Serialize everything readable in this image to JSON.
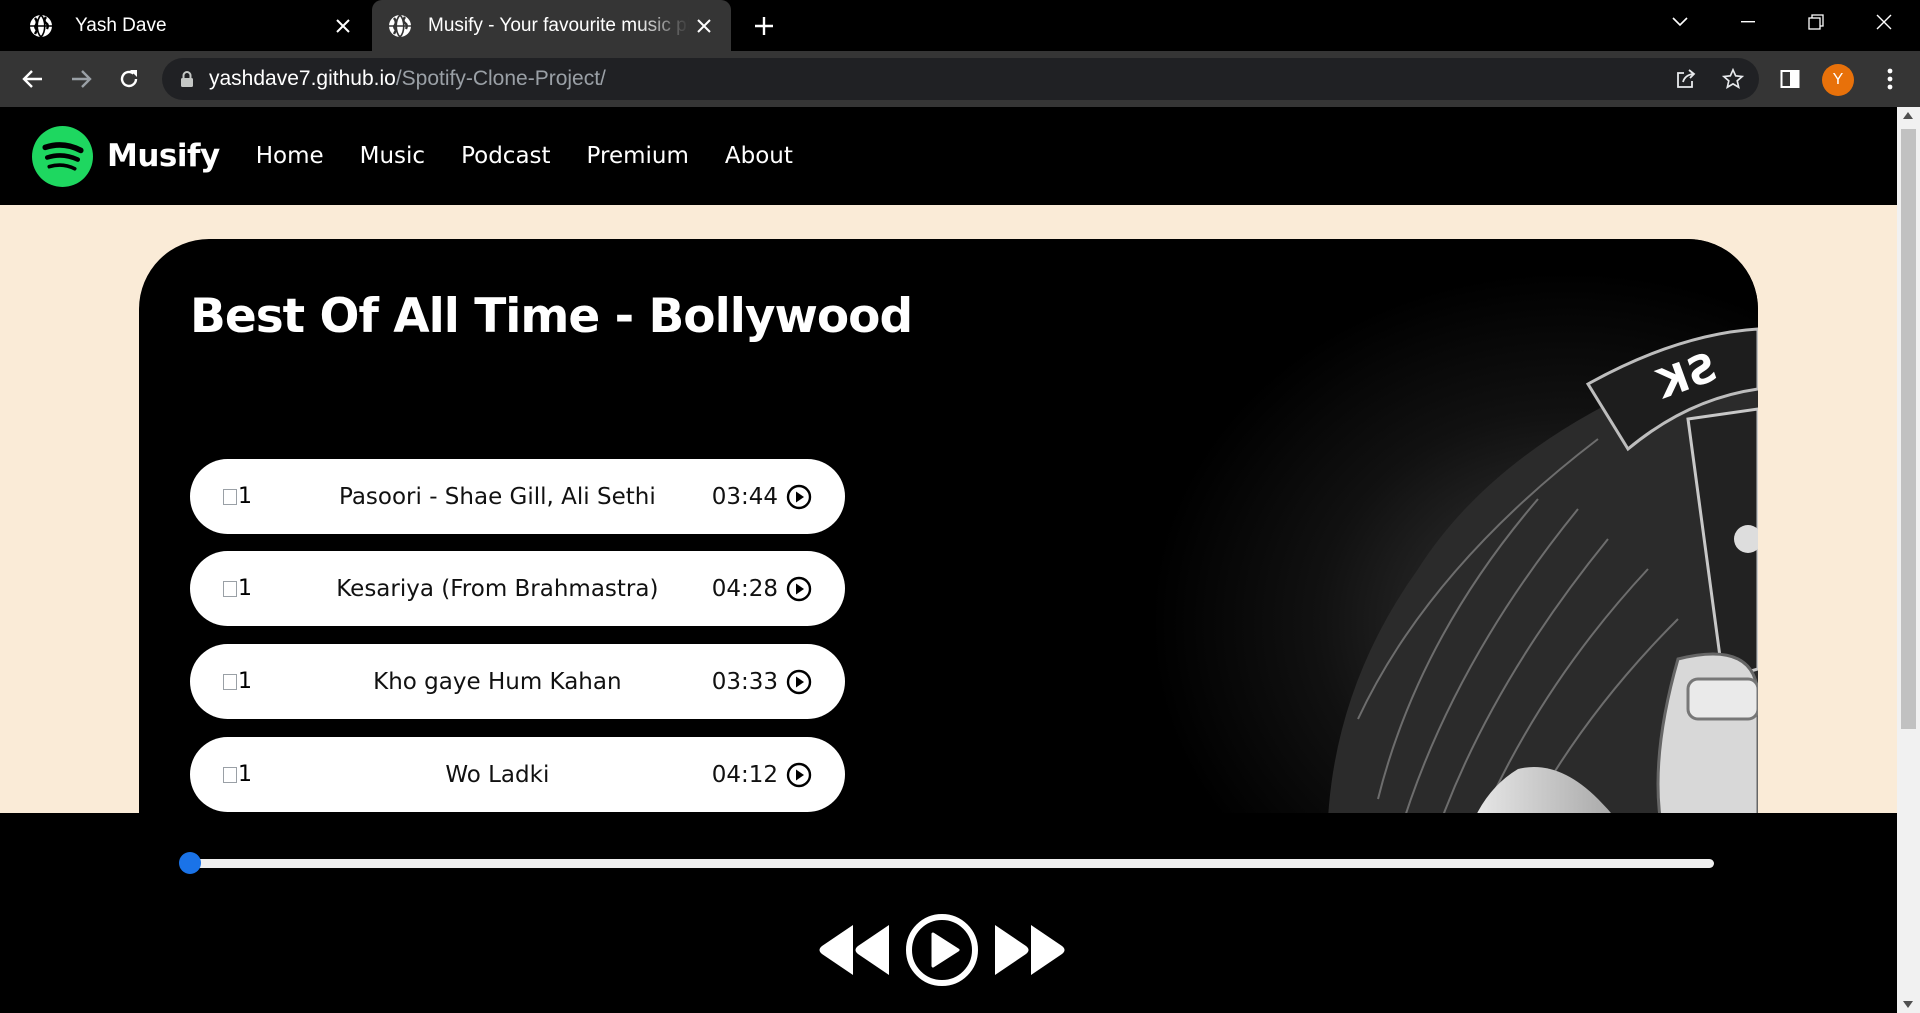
{
  "browser": {
    "tabs": [
      {
        "title": "Yash Dave",
        "active": false
      },
      {
        "title": "Musify - Your favourite music platform",
        "active": true
      }
    ],
    "url_host": "yashdave7.github.io",
    "url_path": "/Spotify-Clone-Project/",
    "profile_initial": "Y",
    "profile_color": "#e8710a"
  },
  "site": {
    "brand": "Musify",
    "nav": [
      "Home",
      "Music",
      "Podcast",
      "Premium",
      "About"
    ],
    "accent": "#1ed760"
  },
  "playlist": {
    "title": "Best Of All Time - Bollywood",
    "songs": [
      {
        "img_alt": "1",
        "name": "Pasoori - Shae Gill, Ali Sethi",
        "duration": "03:44"
      },
      {
        "img_alt": "1",
        "name": "Kesariya (From Brahmastra)",
        "duration": "04:28"
      },
      {
        "img_alt": "1",
        "name": "Kho gaye Hum Kahan",
        "duration": "03:33"
      },
      {
        "img_alt": "1",
        "name": "Wo Ladki",
        "duration": "04:12"
      }
    ]
  },
  "player": {
    "progress_percent": 0,
    "controls": [
      "previous-icon",
      "play-icon",
      "next-icon"
    ]
  }
}
